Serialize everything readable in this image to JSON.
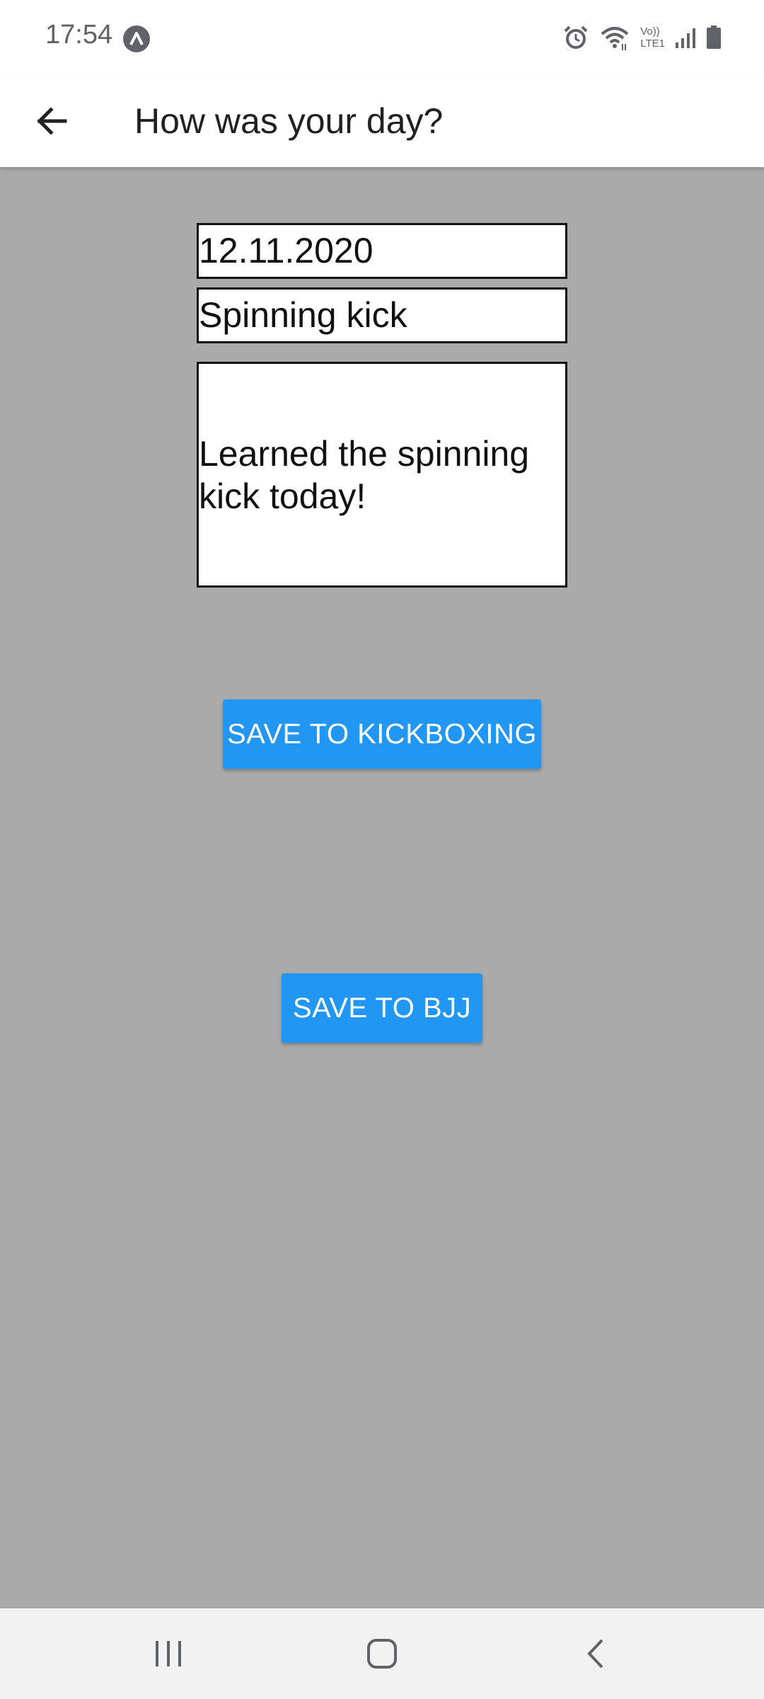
{
  "status_bar": {
    "time": "17:54",
    "icons": [
      "app-notification-icon",
      "alarm-icon",
      "wifi-icon",
      "volte-icon",
      "signal-icon",
      "battery-icon"
    ],
    "volte_top": "Vo))",
    "volte_bottom": "LTE1"
  },
  "app_bar": {
    "back_icon": "arrow-left-icon",
    "title": "How was your day?"
  },
  "form": {
    "date_value": "12.11.2020",
    "title_value": "Spinning kick",
    "notes_value": "Learned the spinning kick today!"
  },
  "buttons": {
    "save_kickboxing": "SAVE TO KICKBOXING",
    "save_bjj": "SAVE TO BJJ"
  },
  "nav_bar": {
    "recents_icon": "recents-icon",
    "home_icon": "home-icon",
    "back_icon": "back-chevron-icon"
  },
  "colors": {
    "accent": "#2196f3",
    "background": "#aaaaaa",
    "app_bar": "#ffffff",
    "nav_bar": "#f2f2f2"
  }
}
